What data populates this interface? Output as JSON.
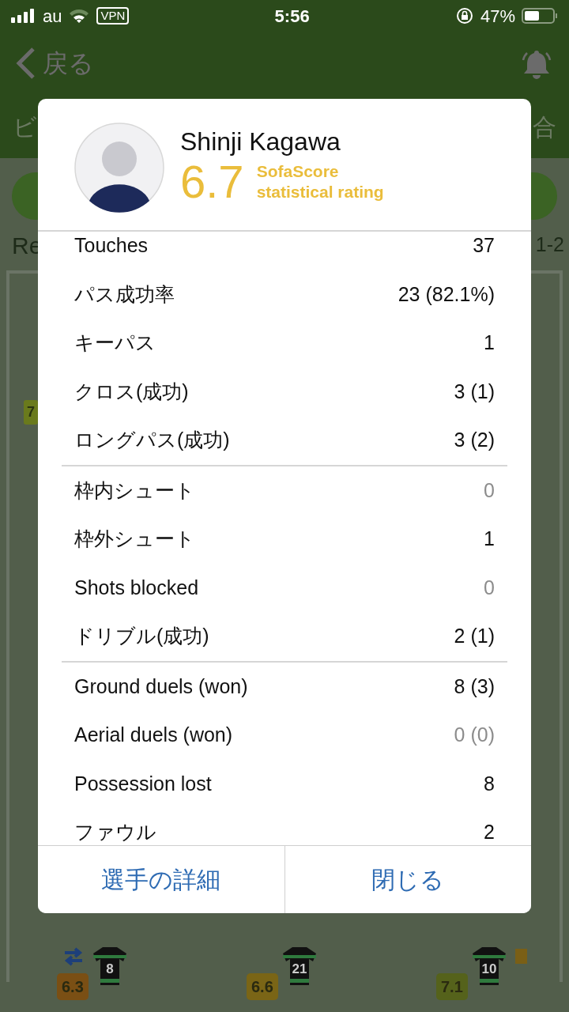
{
  "status_bar": {
    "carrier": "au",
    "vpn": "VPN",
    "time": "5:56",
    "battery": "47%"
  },
  "nav": {
    "back": "戻る"
  },
  "tabs": [
    {
      "label": "ビ",
      "selected": false
    },
    {
      "label": "合",
      "selected": false
    }
  ],
  "match_row": {
    "team": "Re",
    "score": "1-2"
  },
  "edge_rating": "7",
  "lineup": [
    {
      "number": "8",
      "rating": "6.3",
      "color": "#7a4f14",
      "substituted": true,
      "booked": false
    },
    {
      "number": "21",
      "rating": "6.6",
      "color": "#7a6516",
      "substituted": false,
      "booked": false
    },
    {
      "number": "10",
      "rating": "7.1",
      "color": "#55621b",
      "substituted": false,
      "booked": true
    }
  ],
  "dialog": {
    "player": "Shinji Kagawa",
    "rating": "6.7",
    "rating_label": "SofaScore statistical rating",
    "groups": [
      {
        "stats": [
          {
            "label": "Touches",
            "value": "37",
            "dimmed": false
          },
          {
            "label": "パス成功率",
            "value": "23 (82.1%)",
            "dimmed": false
          },
          {
            "label": "キーパス",
            "value": "1",
            "dimmed": false
          },
          {
            "label": "クロス(成功)",
            "value": "3 (1)",
            "dimmed": false
          },
          {
            "label": "ロングパス(成功)",
            "value": "3 (2)",
            "dimmed": false
          }
        ]
      },
      {
        "stats": [
          {
            "label": "枠内シュート",
            "value": "0",
            "dimmed": true
          },
          {
            "label": "枠外シュート",
            "value": "1",
            "dimmed": false
          },
          {
            "label": "Shots blocked",
            "value": "0",
            "dimmed": true
          },
          {
            "label": "ドリブル(成功)",
            "value": "2 (1)",
            "dimmed": false
          }
        ]
      },
      {
        "stats": [
          {
            "label": "Ground duels (won)",
            "value": "8 (3)",
            "dimmed": false
          },
          {
            "label": "Aerial duels (won)",
            "value": "0 (0)",
            "dimmed": true
          },
          {
            "label": "Possession lost",
            "value": "8",
            "dimmed": false
          },
          {
            "label": "ファウル",
            "value": "2",
            "dimmed": false
          }
        ]
      }
    ],
    "buttons": [
      "選手の詳細",
      "閉じる"
    ]
  }
}
